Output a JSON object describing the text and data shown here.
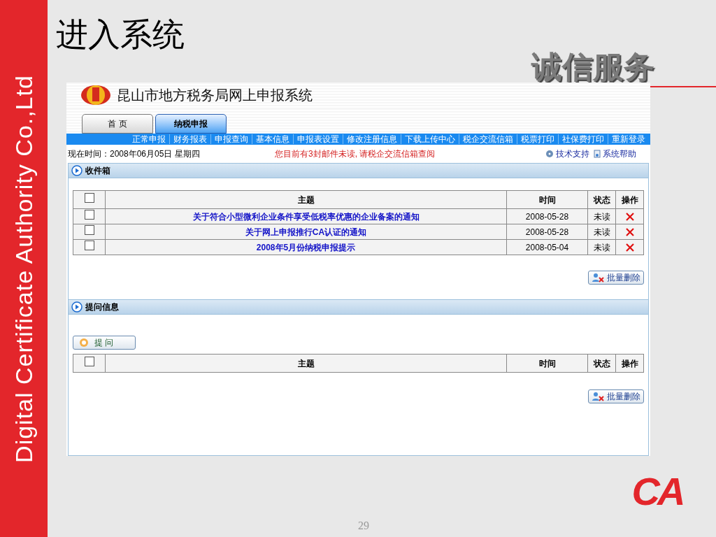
{
  "slide": {
    "title": "进入系统",
    "slogan": "诚信服务",
    "side_text": "Digital Certificate Authority Co.,Ltd",
    "page_number": "29",
    "logo": "CA"
  },
  "app": {
    "system_title": "昆山市地方税务局网上申报系统",
    "tabs": [
      {
        "label": "首 页",
        "selected": false
      },
      {
        "label": "纳税申报",
        "selected": true
      }
    ],
    "nav_items": [
      "正常申报",
      "财务报表",
      "申报查询",
      "基本信息",
      "申报表设置",
      "修改注册信息",
      "下载上传中心",
      "税企交流信箱",
      "税票打印",
      "社保费打印",
      "重新登录"
    ],
    "current_time": "现在时间：2008年06月05日 星期四",
    "notice": "您目前有3封邮件未读, 请税企交流信箱查阅",
    "help_links": [
      {
        "label": "技术支持",
        "kind": "support"
      },
      {
        "label": "系统帮助",
        "kind": "help"
      }
    ],
    "inbox": {
      "title": "收件箱",
      "columns": [
        "主题",
        "时间",
        "状态",
        "操作"
      ],
      "select_all_checked": false,
      "rows": [
        {
          "subject": "关于符合小型微利企业条件享受低税率优惠的企业备案的通知",
          "time": "2008-05-28",
          "status": "未读",
          "checked": false
        },
        {
          "subject": "关于网上申报推行CA认证的通知",
          "time": "2008-05-28",
          "status": "未读",
          "checked": false
        },
        {
          "subject": "2008年5月份纳税申报提示",
          "time": "2008-05-04",
          "status": "未读",
          "checked": false
        }
      ],
      "batch_delete": "批量删除"
    },
    "questions": {
      "title": "提问信息",
      "ask_button": "提 问",
      "columns": [
        "主题",
        "时间",
        "状态",
        "操作"
      ],
      "select_all_checked": false,
      "batch_delete": "批量删除"
    }
  }
}
